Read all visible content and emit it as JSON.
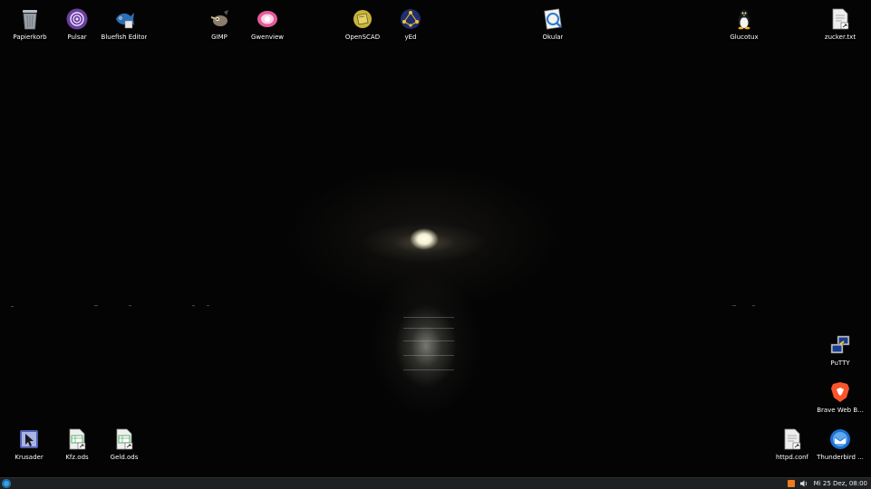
{
  "desktop": {
    "icons": [
      {
        "label": "Papierkorb",
        "icon": "trash-icon"
      },
      {
        "label": "Pulsar",
        "icon": "pulsar-icon"
      },
      {
        "label": "Bluefish Editor",
        "icon": "bluefish-icon"
      },
      {
        "label": "GIMP",
        "icon": "gimp-icon"
      },
      {
        "label": "Gwenview",
        "icon": "gwenview-icon"
      },
      {
        "label": "OpenSCAD",
        "icon": "openscad-icon"
      },
      {
        "label": "yEd",
        "icon": "yed-icon"
      },
      {
        "label": "Okular",
        "icon": "okular-icon"
      },
      {
        "label": "Glucotux",
        "icon": "tux-icon"
      },
      {
        "label": "zucker.txt",
        "icon": "text-file-icon"
      },
      {
        "label": "PuTTY",
        "icon": "putty-icon"
      },
      {
        "label": "Brave Web B...",
        "icon": "brave-icon"
      },
      {
        "label": "Krusader",
        "icon": "krusader-icon"
      },
      {
        "label": "Kfz.ods",
        "icon": "spreadsheet-file-icon"
      },
      {
        "label": "Geld.ods",
        "icon": "spreadsheet-file-icon"
      },
      {
        "label": "httpd.conf",
        "icon": "config-file-icon"
      },
      {
        "label": "Thunderbird ...",
        "icon": "thunderbird-icon"
      }
    ]
  },
  "taskbar": {
    "clock": "Mi 25 Dez, 08:00",
    "tray_icons": [
      "rss-icon",
      "speaker-icon"
    ]
  },
  "colors": {
    "taskbar_bg": "#1e2124",
    "wallpaper_bg": "#040404",
    "start_accent": "#3aa0e0",
    "rss_orange": "#f07b1e"
  }
}
